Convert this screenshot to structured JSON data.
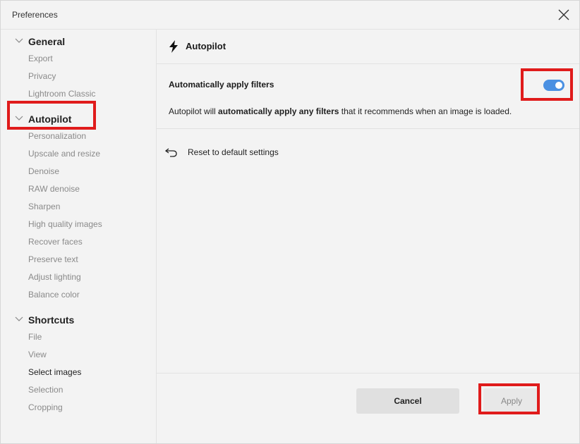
{
  "window": {
    "title": "Preferences"
  },
  "sidebar": {
    "groups": [
      {
        "label": "General",
        "items": [
          "Export",
          "Privacy",
          "Lightroom Classic"
        ]
      },
      {
        "label": "Autopilot",
        "items": [
          "Personalization",
          "Upscale and resize",
          "Denoise",
          "RAW denoise",
          "Sharpen",
          "High quality images",
          "Recover faces",
          "Preserve text",
          "Adjust lighting",
          "Balance color"
        ]
      },
      {
        "label": "Shortcuts",
        "items": [
          "File",
          "View",
          "Select images",
          "Selection",
          "Cropping"
        ]
      }
    ]
  },
  "main": {
    "title": "Autopilot",
    "title_icon": "lightning-bolt-icon",
    "setting": {
      "label": "Automatically apply filters",
      "enabled": true,
      "desc_prefix": "Autopilot will ",
      "desc_bold": "automatically apply any filters",
      "desc_suffix": " that it recommends when an image is loaded."
    },
    "reset_label": "Reset to default settings"
  },
  "footer": {
    "cancel_label": "Cancel",
    "apply_label": "Apply"
  },
  "colors": {
    "accent": "#4a90e2",
    "highlight": "#e01b1b"
  }
}
